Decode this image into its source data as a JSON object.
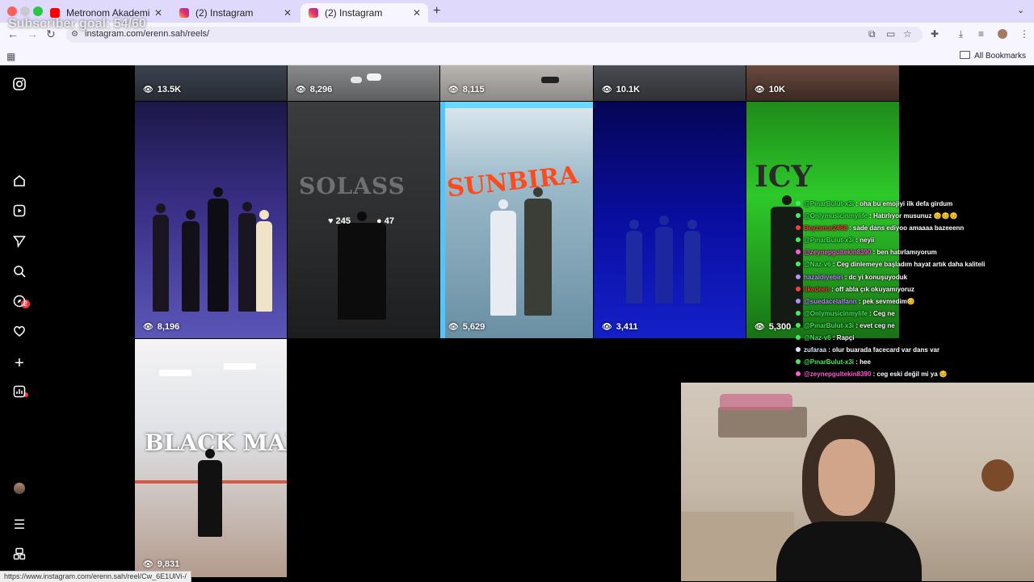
{
  "overlay": {
    "subscriber_goal": "Subscriber goal: 54/60"
  },
  "browser": {
    "tabs": [
      {
        "title": "Metronom Akademi - YouTube",
        "icon": "youtube-icon",
        "active": false
      },
      {
        "title": "(2) Instagram",
        "icon": "instagram-icon",
        "active": false
      },
      {
        "title": "(2) Instagram",
        "icon": "instagram-icon",
        "active": true
      }
    ],
    "url": "instagram.com/erenn.sah/reels/",
    "bookmarks_label": "All Bookmarks",
    "status_url": "https://www.instagram.com/erenn.sah/reel/Cw_6E1UlVi-/"
  },
  "sidebar": {
    "items": [
      "instagram-logo-icon",
      "home-icon",
      "reels-icon",
      "messenger-icon",
      "search-icon",
      "explore-icon",
      "notifications-heart-icon",
      "create-plus-icon",
      "dashboard-icon",
      "profile-avatar",
      "more-menu-icon",
      "threads-icon"
    ],
    "messages_badge": "2"
  },
  "reels": {
    "top_row": [
      {
        "views": "13.5K"
      },
      {
        "views": "8,296"
      },
      {
        "views": "8,115"
      },
      {
        "views": "10.1K"
      },
      {
        "views": "10K"
      }
    ],
    "middle_row": [
      {
        "views": "8,196",
        "text": ""
      },
      {
        "views": "",
        "text": "SOLASS",
        "likes": "245",
        "comments": "47"
      },
      {
        "views": "5,629",
        "text": "SUNBIRA"
      },
      {
        "views": "3,411",
        "text": ""
      },
      {
        "views": "5,300",
        "text": "ICY"
      }
    ],
    "bottom_row": [
      {
        "views": "9,831",
        "text": "BLACK MAMBA"
      }
    ]
  },
  "chat": [
    {
      "user": "@PınarBulut-x3i",
      "msg": "oha bu emojiyi ilk defa girdum",
      "color": "#3ef05a"
    },
    {
      "user": "@Onlymusicinmylife",
      "msg": "Hatırlıyor musunuz 😊😊😊",
      "color": "#3ef05a"
    },
    {
      "user": "Beyzanur2468",
      "msg": "sade dans ediyoo amaaaa bazeeenn",
      "color": "#ff3b3b"
    },
    {
      "user": "@PınarBulut-x3i",
      "msg": "neyii",
      "color": "#3ef05a"
    },
    {
      "user": "@zeynepgultekin8390",
      "msg": "ben hatırlamıyorum",
      "color": "#ff5ad0"
    },
    {
      "user": "@Naz-v6",
      "msg": "Ceg dinlemeye başladım hayat artık daha kaliteli",
      "color": "#3ef05a"
    },
    {
      "user": "hazaldiyebiri",
      "msg": "dc yi konuşuyoduk",
      "color": "#b98cff"
    },
    {
      "user": "ilkedeen",
      "msg": "off abla çık okuyamıyoruz",
      "color": "#ff3b3b"
    },
    {
      "user": "@suedacelalfann",
      "msg": "pek sevmedim😊",
      "color": "#b98cff"
    },
    {
      "user": "@Onlymusicinmylife",
      "msg": "Ceg ne",
      "color": "#3ef05a"
    },
    {
      "user": "@PınarBulut-x3i",
      "msg": "evet ceg ne",
      "color": "#3ef05a"
    },
    {
      "user": "@Naz-v6",
      "msg": "Rapçi",
      "color": "#3ef05a"
    },
    {
      "user": "zufaraa",
      "msg": "olur buarada facecard var dans var",
      "color": "#d9e6ff"
    },
    {
      "user": "@PınarBulut-x3i",
      "msg": "hee",
      "color": "#3ef05a"
    },
    {
      "user": "@zeynepgultekin8390",
      "msg": "ceg eski değil mi ya 😊",
      "color": "#ff5ad0"
    }
  ]
}
